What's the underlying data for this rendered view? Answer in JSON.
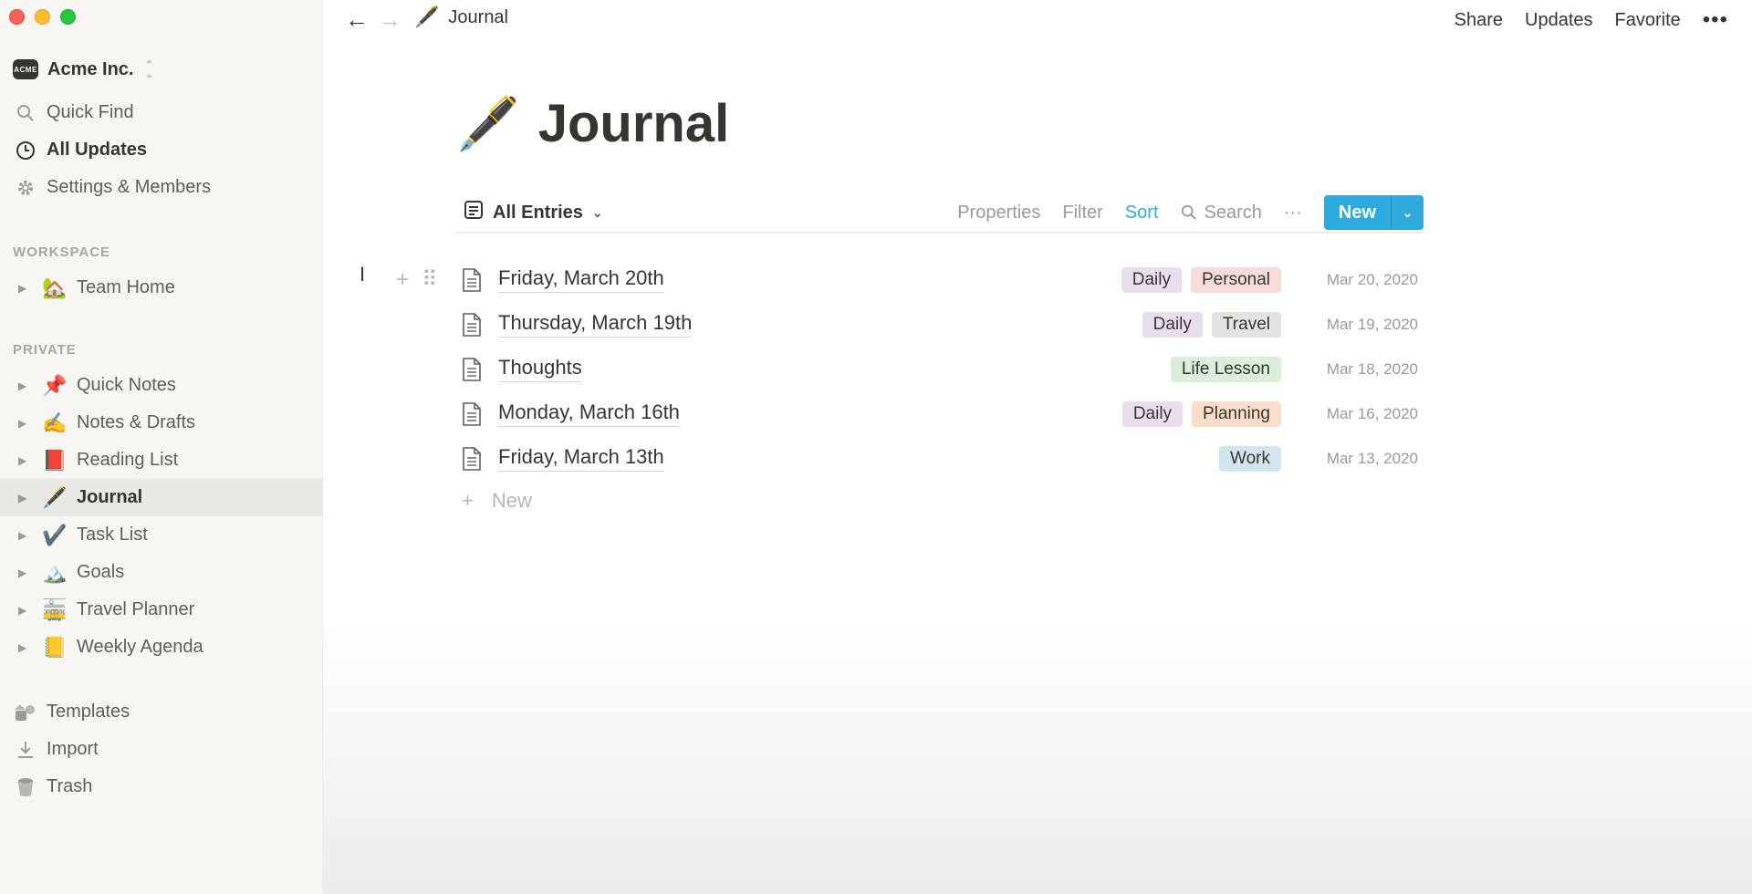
{
  "window": {
    "controls": [
      "close",
      "minimize",
      "zoom"
    ]
  },
  "sidebar": {
    "workspace": {
      "logo_text": "ACME",
      "name": "Acme Inc."
    },
    "top_items": [
      {
        "label": "Quick Find",
        "icon": "search-icon"
      },
      {
        "label": "All Updates",
        "icon": "clock-icon"
      },
      {
        "label": "Settings & Members",
        "icon": "gear-icon"
      }
    ],
    "workspace_label": "WORKSPACE",
    "workspace_pages": [
      {
        "label": "Team Home",
        "emoji": "🏡"
      }
    ],
    "private_label": "PRIVATE",
    "private_pages": [
      {
        "label": "Quick Notes",
        "emoji": "📌"
      },
      {
        "label": "Notes & Drafts",
        "emoji": "✍️"
      },
      {
        "label": "Reading List",
        "emoji": "📕"
      },
      {
        "label": "Journal",
        "emoji": "🖋️",
        "active": true
      },
      {
        "label": "Task List",
        "emoji": "✔️"
      },
      {
        "label": "Goals",
        "emoji": "🏔️"
      },
      {
        "label": "Travel Planner",
        "emoji": "🚋"
      },
      {
        "label": "Weekly Agenda",
        "emoji": "📒"
      }
    ],
    "bottom_items": [
      {
        "label": "Templates",
        "icon": "templates-icon"
      },
      {
        "label": "Import",
        "icon": "import-icon"
      },
      {
        "label": "Trash",
        "icon": "trash-icon"
      }
    ]
  },
  "topbar": {
    "breadcrumb": {
      "emoji": "🖋️",
      "label": "Journal"
    },
    "actions": {
      "share": "Share",
      "updates": "Updates",
      "favorite": "Favorite",
      "more": "•••"
    }
  },
  "page": {
    "emoji": "🖋️",
    "title": "Journal",
    "toolbar": {
      "view": "All Entries",
      "properties": "Properties",
      "filter": "Filter",
      "sort": "Sort",
      "search": "Search",
      "more": "···",
      "new": "New"
    },
    "entries": [
      {
        "title": "Friday, March 20th",
        "tags": [
          {
            "label": "Daily",
            "color": "#e8deee"
          },
          {
            "label": "Personal",
            "color": "#f8dcdb"
          }
        ],
        "date": "Mar 20, 2020"
      },
      {
        "title": "Thursday, March 19th",
        "tags": [
          {
            "label": "Daily",
            "color": "#e8deee"
          },
          {
            "label": "Travel",
            "color": "#e3e2e0"
          }
        ],
        "date": "Mar 19, 2020"
      },
      {
        "title": "Thoughts",
        "tags": [
          {
            "label": "Life Lesson",
            "color": "#dbeddb"
          }
        ],
        "date": "Mar 18, 2020"
      },
      {
        "title": "Monday, March 16th",
        "tags": [
          {
            "label": "Daily",
            "color": "#e8deee"
          },
          {
            "label": "Planning",
            "color": "#fadec9"
          }
        ],
        "date": "Mar 16, 2020"
      },
      {
        "title": "Friday, March 13th",
        "tags": [
          {
            "label": "Work",
            "color": "#d3e5ef"
          }
        ],
        "date": "Mar 13, 2020"
      }
    ],
    "new_row_label": "New"
  },
  "colors": {
    "accent": "#2eaadc",
    "sidebar_bg": "#f7f6f3",
    "text": "#37352f",
    "muted": "#9b9a97"
  }
}
